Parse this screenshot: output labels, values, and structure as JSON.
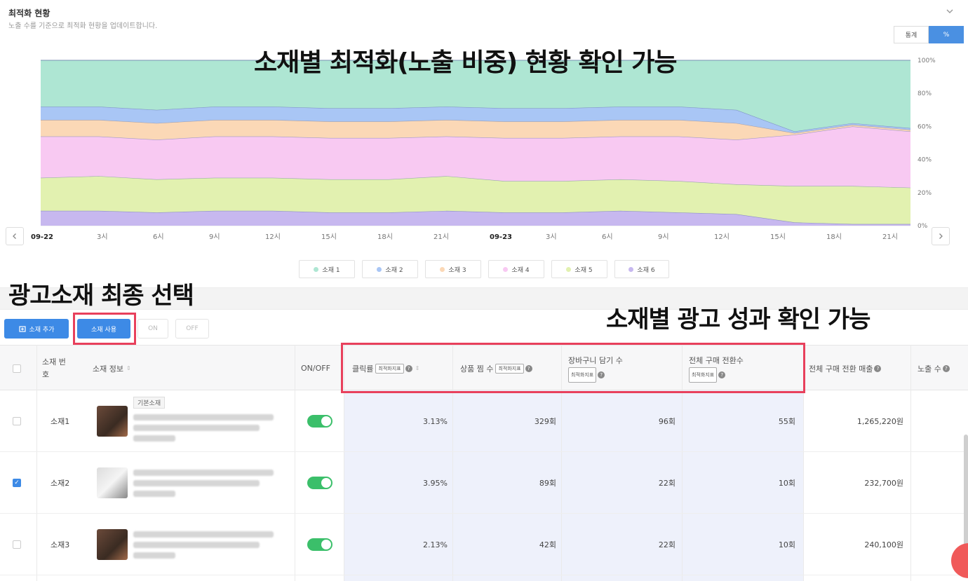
{
  "header": {
    "title": "최적화 현황",
    "subtitle": "노출 수를 기준으로 최적화 현황을 업데이트합니다."
  },
  "view_toggle": {
    "stats_label": "통계",
    "percent_label": "%",
    "active": "%"
  },
  "annotations": {
    "top": "소재별 최적화(노출 비중) 현황 확인 가능",
    "left": "광고소재 최종 선택",
    "right": "소재별 광고 성과 확인 가능"
  },
  "chart_data": {
    "type": "area",
    "stacked": true,
    "x": [
      "09-22",
      "3시",
      "6시",
      "9시",
      "12시",
      "15시",
      "18시",
      "21시",
      "09-23",
      "3시",
      "6시",
      "9시",
      "12시",
      "15시",
      "18시",
      "21시"
    ],
    "x_bold": [
      "09-22",
      "09-23"
    ],
    "y_ticks": [
      "100%",
      "80%",
      "60%",
      "40%",
      "20%",
      "0%"
    ],
    "ylim": [
      0,
      100
    ],
    "y_tick_values": [
      100,
      80,
      60,
      40,
      20,
      0
    ],
    "series": [
      {
        "name": "소재 1",
        "color": "#aee6d3",
        "values": [
          28,
          28,
          30,
          31,
          30,
          29,
          29,
          30,
          29,
          29,
          29,
          28,
          31,
          43,
          38,
          41
        ]
      },
      {
        "name": "소재 2",
        "color": "#a9c6f5",
        "values": [
          8,
          8,
          8,
          8,
          8,
          8,
          8,
          8,
          8,
          8,
          8,
          8,
          8,
          1,
          1,
          1
        ]
      },
      {
        "name": "소재 3",
        "color": "#fbd8b6",
        "values": [
          10,
          10,
          10,
          10,
          10,
          10,
          10,
          10,
          10,
          10,
          10,
          10,
          10,
          1,
          1,
          1
        ]
      },
      {
        "name": "소재 4",
        "color": "#f8c9f2",
        "values": [
          25,
          24,
          24,
          25,
          25,
          25,
          25,
          24,
          26,
          26,
          26,
          27,
          27,
          31,
          36,
          34
        ]
      },
      {
        "name": "소재 5",
        "color": "#e2f1b0",
        "values": [
          20,
          21,
          20,
          20,
          20,
          20,
          20,
          21,
          19,
          19,
          19,
          19,
          18,
          22,
          23,
          22
        ]
      },
      {
        "name": "소재 6",
        "color": "#c7b8ef",
        "values": [
          9,
          9,
          8,
          9,
          9,
          8,
          8,
          9,
          8,
          8,
          9,
          8,
          7,
          2,
          1,
          1
        ]
      }
    ]
  },
  "legend": [
    "소재 1",
    "소재 2",
    "소재 3",
    "소재 4",
    "소재 5",
    "소재 6"
  ],
  "toolbar": {
    "add": "소재 추가",
    "use": "소재 사용",
    "on": "ON",
    "off": "OFF"
  },
  "table": {
    "headers": {
      "no": "소재 번호",
      "info": "소재 정보",
      "onoff": "ON/OFF",
      "ctr": "클릭률",
      "wish": "상품 찜 수",
      "cart": "장바구니 담기 수",
      "conv": "전체 구매 전환수",
      "revenue": "전체 구매 전환 매출",
      "impressions": "노출 수",
      "opt_tag": "최적화지표"
    },
    "base_tag": "기본소재",
    "rows": [
      {
        "no": "소재1",
        "checked": false,
        "ctr": "3.13%",
        "wish": "329회",
        "cart": "96회",
        "conv": "55회",
        "revenue": "1,265,220원"
      },
      {
        "no": "소재2",
        "checked": true,
        "ctr": "3.95%",
        "wish": "89회",
        "cart": "22회",
        "conv": "10회",
        "revenue": "232,700원"
      },
      {
        "no": "소재3",
        "checked": false,
        "ctr": "2.13%",
        "wish": "42회",
        "cart": "22회",
        "conv": "10회",
        "revenue": "240,100원"
      }
    ]
  }
}
